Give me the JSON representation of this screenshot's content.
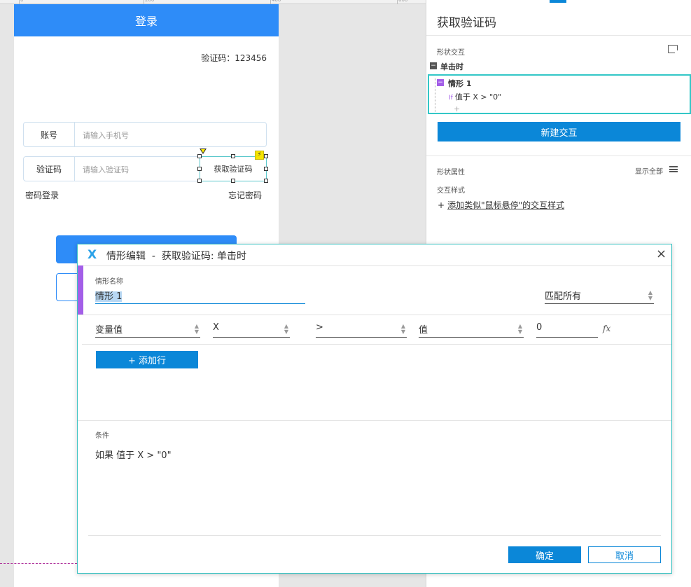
{
  "ruler": {
    "marks": [
      "0",
      "200",
      "400",
      "600"
    ]
  },
  "prototype": {
    "header_title": "登录",
    "code_display": "验证码：123456",
    "account_label": "账号",
    "account_placeholder": "请输入手机号",
    "code_label": "验证码",
    "code_placeholder": "请输入验证码",
    "get_code_button": "获取验证码",
    "password_login": "密码登录",
    "forgot_password": "忘记密码"
  },
  "right_panel": {
    "title": "获取验证码",
    "section_interaction": "形状交互",
    "event_click": "单击时",
    "case_name": "情形 1",
    "case_if_keyword": "If",
    "case_condition": "值于 X > \"0\"",
    "case_add": "+",
    "new_interaction_button": "新建交互",
    "section_properties": "形状属性",
    "show_all": "显示全部",
    "interaction_style_label": "交互样式",
    "add_style_plus": "+",
    "add_style_link": "添加类似\"鼠标悬停\"的交互样式"
  },
  "dialog": {
    "logo": "X",
    "title": "情形编辑  -  获取验证码: 单击时",
    "close": "×",
    "name_label": "情形名称",
    "name_value": "情形 1",
    "match_value": "匹配所有",
    "condition_row": {
      "target": "变量值",
      "variable": "X",
      "operator": ">",
      "type": "值",
      "value": "0"
    },
    "fx": "fx",
    "add_row_button": "+ 添加行",
    "conditions_label": "条件",
    "conditions_text": "如果 值于 X > \"0\"",
    "ok_button": "确定",
    "cancel_button": "取消"
  },
  "colors": {
    "accent_blue": "#0b87d8",
    "header_blue": "#2e8cf8",
    "selection_cyan": "#33c7c7",
    "case_purple": "#a35ee8"
  }
}
